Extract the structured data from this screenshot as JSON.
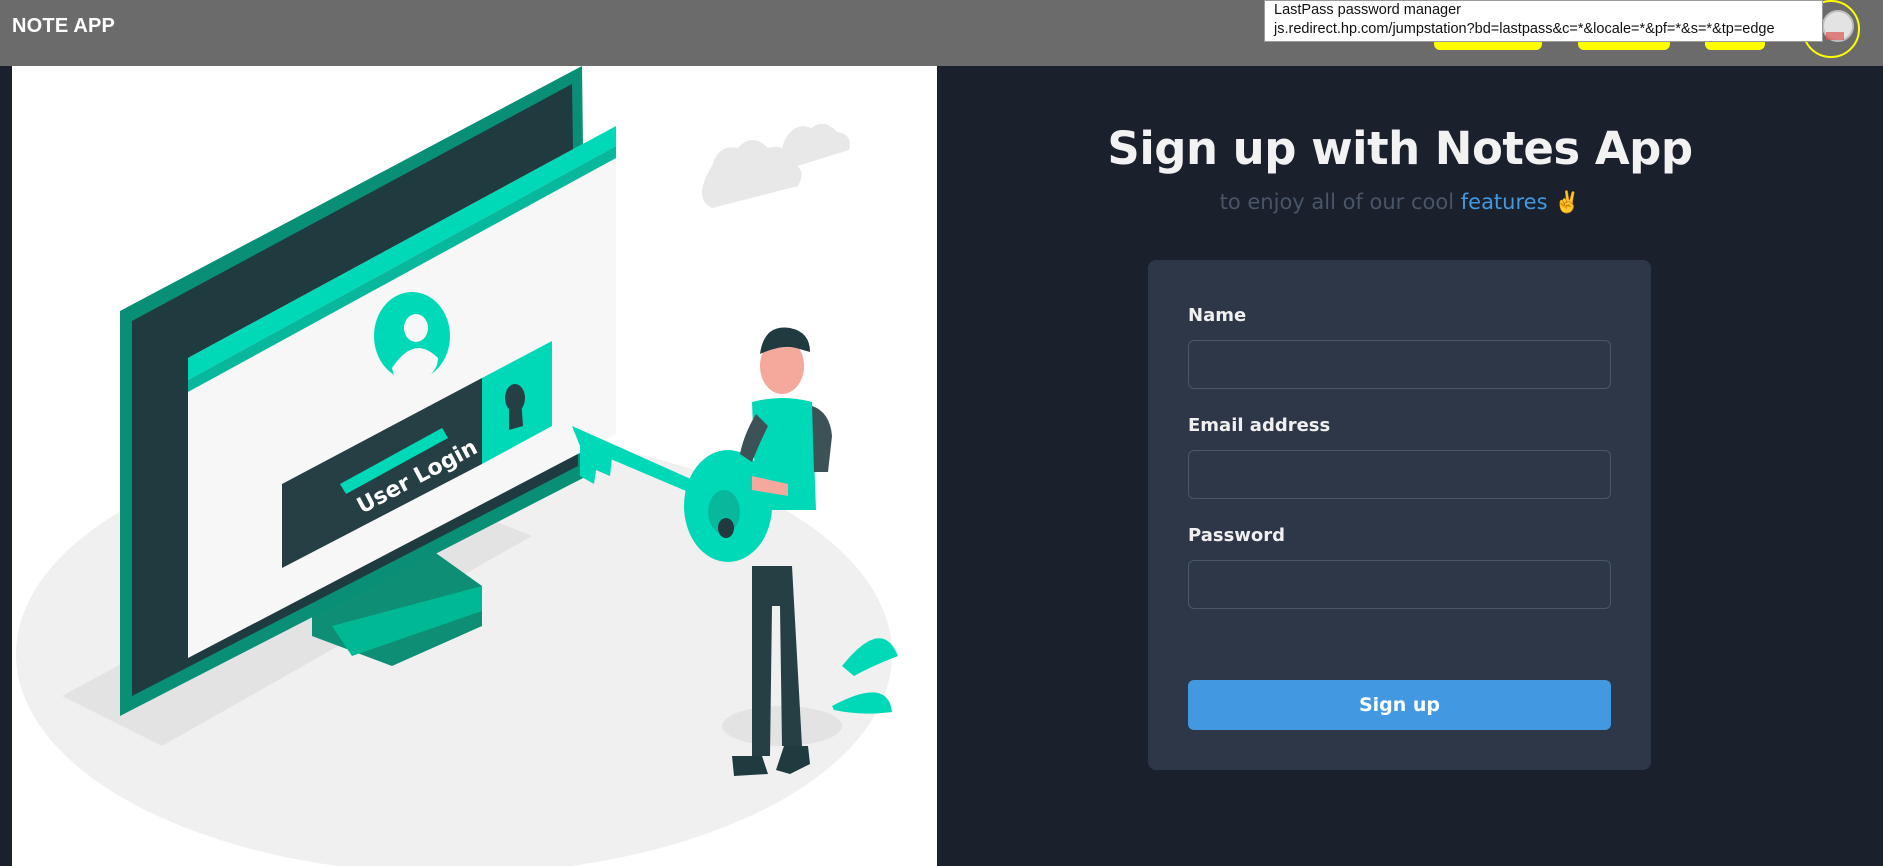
{
  "navbar": {
    "brand": "NOTE APP"
  },
  "tooltip": {
    "title": "LastPass password manager",
    "url": "js.redirect.hp.com/jumpstation?bd=lastpass&c=*&locale=*&pf=*&s=*&tp=edge"
  },
  "illustration": {
    "login_label": "User Login"
  },
  "hero": {
    "title": "Sign up with Notes App",
    "subtitle_prefix": "to enjoy all of our cool ",
    "subtitle_highlight": "features",
    "subtitle_emoji": "✌️"
  },
  "form": {
    "name_label": "Name",
    "name_value": "",
    "email_label": "Email address",
    "email_value": "",
    "password_label": "Password",
    "password_value": "",
    "submit_label": "Sign up"
  },
  "colors": {
    "navbar": "#6b6b6b",
    "page_bg": "#1a202c",
    "card_bg": "#2d3748",
    "accent_blue": "#4299e1",
    "teal": "#00d9b8",
    "nav_highlight": "#ffff00"
  }
}
